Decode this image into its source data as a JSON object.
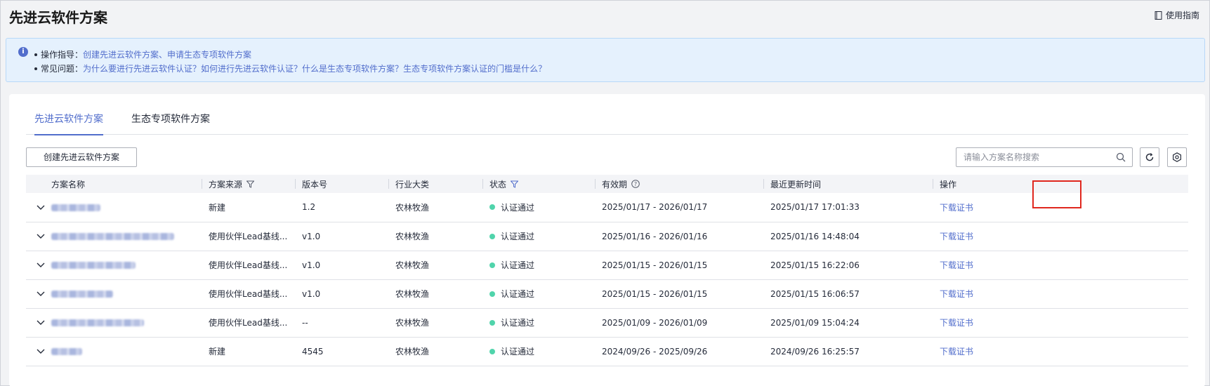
{
  "page": {
    "title": "先进云软件方案",
    "guide_label": "使用指南"
  },
  "tips": {
    "line1_label": "操作指导：",
    "line1_links": [
      "创建先进云软件方案",
      "、",
      "申请生态专项软件方案"
    ],
    "line2_label": "常见问题：",
    "line2_links": [
      "为什么要进行先进云软件认证？",
      "如何进行先进云软件认证？",
      "什么是生态专项软件方案？",
      "生态专项软件方案认证的门槛是什么？"
    ]
  },
  "tabs": [
    {
      "label": "先进云软件方案",
      "active": true
    },
    {
      "label": "生态专项软件方案",
      "active": false
    }
  ],
  "toolbar": {
    "create_label": "创建先进云软件方案",
    "search_placeholder": "请输入方案名称搜索"
  },
  "table": {
    "columns": [
      "方案名称",
      "方案来源",
      "版本号",
      "行业大类",
      "状态",
      "有效期",
      "最近更新时间",
      "操作"
    ],
    "rows": [
      {
        "source": "新建",
        "version": "1.2",
        "industry": "农林牧渔",
        "status": "认证通过",
        "validity": "2025/01/17 - 2026/01/17",
        "updated": "2025/01/17 17:01:33",
        "action": "下载证书"
      },
      {
        "source": "使用伙伴Lead基线...",
        "version": "v1.0",
        "industry": "农林牧渔",
        "status": "认证通过",
        "validity": "2025/01/16 - 2026/01/16",
        "updated": "2025/01/16 14:48:04",
        "action": "下载证书"
      },
      {
        "source": "使用伙伴Lead基线...",
        "version": "v1.0",
        "industry": "农林牧渔",
        "status": "认证通过",
        "validity": "2025/01/15 - 2026/01/15",
        "updated": "2025/01/15 16:22:06",
        "action": "下载证书"
      },
      {
        "source": "使用伙伴Lead基线...",
        "version": "v1.0",
        "industry": "农林牧渔",
        "status": "认证通过",
        "validity": "2025/01/15 - 2026/01/15",
        "updated": "2025/01/15 16:06:57",
        "action": "下载证书"
      },
      {
        "source": "使用伙伴Lead基线...",
        "version": "--",
        "industry": "农林牧渔",
        "status": "认证通过",
        "validity": "2025/01/09 - 2026/01/09",
        "updated": "2025/01/09 15:04:24",
        "action": "下载证书"
      },
      {
        "source": "新建",
        "version": "4545",
        "industry": "农林牧渔",
        "status": "认证通过",
        "validity": "2024/09/26 - 2025/09/26",
        "updated": "2024/09/26 16:25:57",
        "action": "下载证书"
      }
    ]
  },
  "colors": {
    "accent": "#526ecc",
    "status_ok": "#50d4ab",
    "highlight": "#e0271e"
  }
}
